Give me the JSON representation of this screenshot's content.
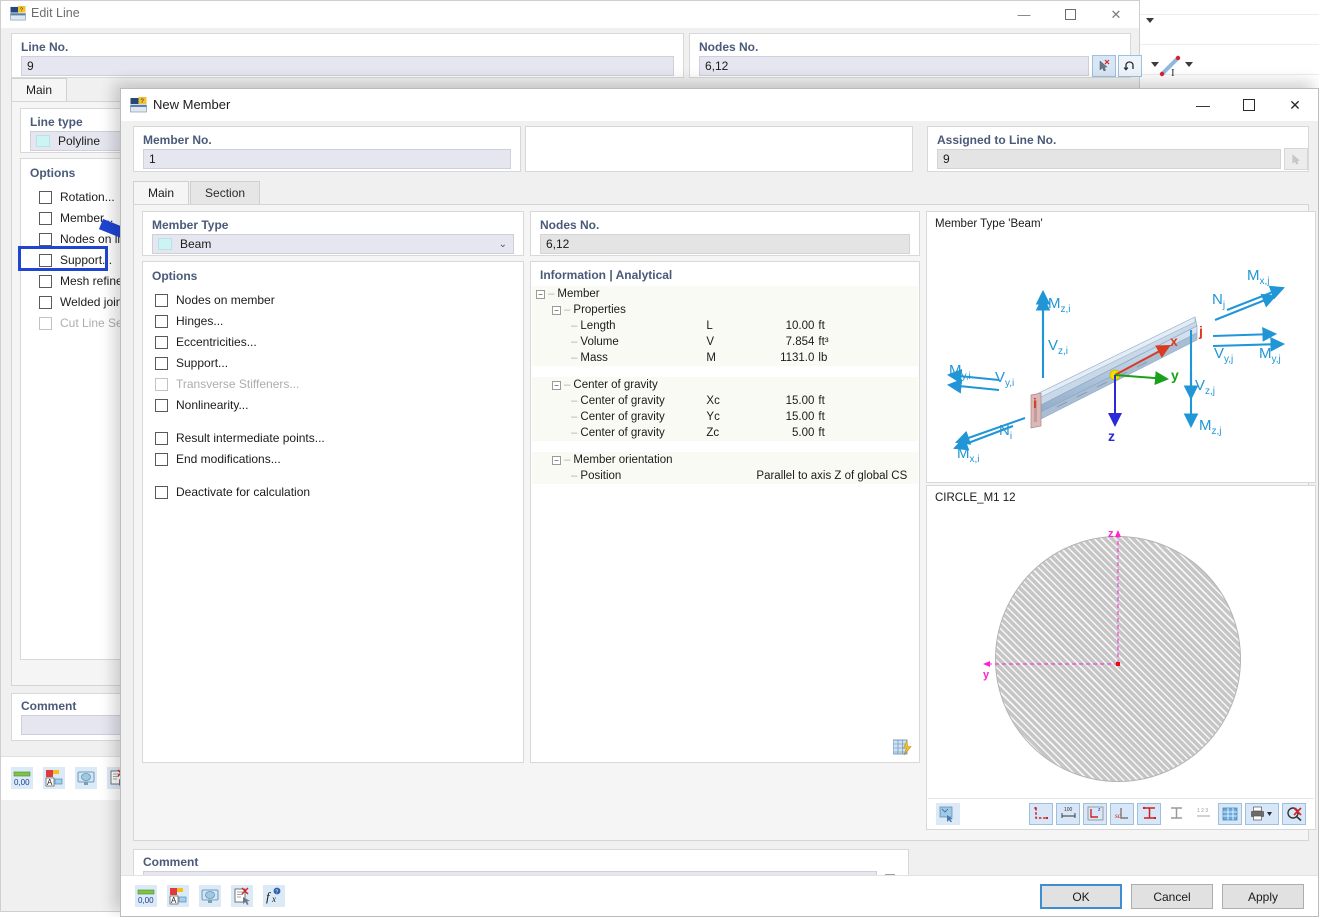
{
  "background_app": {
    "name": "rfem-model-window"
  },
  "edit_line": {
    "title": "Edit Line",
    "icon": "dialog-icon",
    "window_buttons": {
      "minimize": "—",
      "maximize": "☐",
      "close": "✕"
    },
    "line_no": {
      "label": "Line No.",
      "value": "9"
    },
    "nodes_no": {
      "label": "Nodes No.",
      "value": "6,12",
      "pick_icon": "pick-cursor-icon",
      "reverse_icon": "reverse-arrow-icon"
    },
    "tabs": [
      {
        "label": "Main",
        "active": true
      }
    ],
    "line_type": {
      "label": "Line type",
      "value": "Polyline"
    },
    "options": {
      "label": "Options",
      "items": [
        {
          "label": "Rotation...",
          "checked": false,
          "disabled": false,
          "highlighted": false
        },
        {
          "label": "Member...",
          "checked": false,
          "disabled": false,
          "highlighted": true
        },
        {
          "label": "Nodes on line...",
          "checked": false,
          "disabled": false,
          "highlighted": false
        },
        {
          "label": "Support...",
          "checked": false,
          "disabled": false,
          "highlighted": false
        },
        {
          "label": "Mesh refinement...",
          "checked": false,
          "disabled": false,
          "highlighted": false
        },
        {
          "label": "Welded joints...",
          "checked": false,
          "disabled": false,
          "highlighted": false
        },
        {
          "label": "Cut Line Settings...",
          "checked": false,
          "disabled": true,
          "highlighted": false
        }
      ]
    },
    "comment": {
      "label": "Comment",
      "value": ""
    },
    "toolbar_icons": [
      "units-icon",
      "display-properties-icon",
      "view-mode-icon",
      "delete-note-icon"
    ],
    "highlight_color": "#1f45d2",
    "arrow_color": "#1f45d2"
  },
  "new_member": {
    "title": "New Member",
    "icon": "dialog-icon",
    "window_buttons": {
      "minimize": "—",
      "maximize": "☐",
      "close": "✕"
    },
    "member_no": {
      "label": "Member No.",
      "value": "1"
    },
    "assigned_to_line": {
      "label": "Assigned to Line No.",
      "value": "9",
      "pick_icon": "pick-cursor-icon"
    },
    "tabs": [
      {
        "label": "Main",
        "active": true
      },
      {
        "label": "Section",
        "active": false
      }
    ],
    "member_type": {
      "label": "Member Type",
      "value": "Beam",
      "swatch_color": "#cdf4f4",
      "caret": "⌄"
    },
    "nodes_no": {
      "label": "Nodes No.",
      "value": "6,12"
    },
    "options": {
      "label": "Options",
      "items": [
        {
          "label": "Nodes on member",
          "checked": false,
          "disabled": false,
          "gap_after": false
        },
        {
          "label": "Hinges...",
          "checked": false,
          "disabled": false,
          "gap_after": false
        },
        {
          "label": "Eccentricities...",
          "checked": false,
          "disabled": false,
          "gap_after": false
        },
        {
          "label": "Support...",
          "checked": false,
          "disabled": false,
          "gap_after": false
        },
        {
          "label": "Transverse Stiffeners...",
          "checked": false,
          "disabled": true,
          "gap_after": false
        },
        {
          "label": "Nonlinearity...",
          "checked": false,
          "disabled": false,
          "gap_after": true
        },
        {
          "label": "Result intermediate points...",
          "checked": false,
          "disabled": false,
          "gap_after": false
        },
        {
          "label": "End modifications...",
          "checked": false,
          "disabled": false,
          "gap_after": true
        },
        {
          "label": "Deactivate for calculation",
          "checked": false,
          "disabled": false,
          "gap_after": false
        }
      ]
    },
    "information": {
      "label": "Information | Analytical",
      "rows": [
        {
          "kind": "group",
          "indent": 0,
          "expander": "−",
          "label": "Member"
        },
        {
          "kind": "group",
          "indent": 1,
          "expander": "−",
          "label": "Properties"
        },
        {
          "kind": "item",
          "indent": 2,
          "label": "Length",
          "symbol": "L",
          "value": "10.00",
          "unit": "ft"
        },
        {
          "kind": "item",
          "indent": 2,
          "label": "Volume",
          "symbol": "V",
          "value": "7.854",
          "unit": "ft³"
        },
        {
          "kind": "item",
          "indent": 2,
          "label": "Mass",
          "symbol": "M",
          "value": "1131.0",
          "unit": "lb"
        },
        {
          "kind": "blank"
        },
        {
          "kind": "group",
          "indent": 1,
          "expander": "−",
          "label": "Center of gravity"
        },
        {
          "kind": "item",
          "indent": 2,
          "label": "Center of gravity",
          "symbol": "Xc",
          "value": "15.00",
          "unit": "ft"
        },
        {
          "kind": "item",
          "indent": 2,
          "label": "Center of gravity",
          "symbol": "Yc",
          "value": "15.00",
          "unit": "ft"
        },
        {
          "kind": "item",
          "indent": 2,
          "label": "Center of gravity",
          "symbol": "Zc",
          "value": "5.00",
          "unit": "ft"
        },
        {
          "kind": "blank"
        },
        {
          "kind": "group",
          "indent": 1,
          "expander": "−",
          "label": "Member orientation"
        },
        {
          "kind": "item",
          "indent": 2,
          "label": "Position",
          "symbol": "",
          "value": "",
          "unit": "Parallel to axis Z of global CS"
        }
      ],
      "table_icon": "table-lightning-icon"
    },
    "beam_graphic": {
      "caption": "Member Type 'Beam'",
      "labels": [
        {
          "text": "M",
          "sub": "z,i"
        },
        {
          "text": "V",
          "sub": "z,i"
        },
        {
          "text": "M",
          "sub": "y,i"
        },
        {
          "text": "V",
          "sub": "y,i"
        },
        {
          "text": "N",
          "sub": "i"
        },
        {
          "text": "M",
          "sub": "x,i"
        },
        {
          "text": "M",
          "sub": "x,j"
        },
        {
          "text": "N",
          "sub": "j"
        },
        {
          "text": "V",
          "sub": "y,j"
        },
        {
          "text": "M",
          "sub": "y,j"
        },
        {
          "text": "V",
          "sub": "z,j"
        },
        {
          "text": "M",
          "sub": "z,j"
        }
      ],
      "axes": [
        "x",
        "y",
        "z"
      ],
      "nodes": [
        "i",
        "j"
      ],
      "arrow_color": "#2196d6",
      "axis_x_color": "#d93b20",
      "axis_y_color": "#1ba01b",
      "axis_z_color": "#2a2ad6"
    },
    "section_graphic": {
      "caption": "CIRCLE_M1 12",
      "axis_z_label": "z",
      "axis_y_label": "y",
      "axis_color": "#ff22d0",
      "fill_color": "#c6c6c6"
    },
    "section_toolbar_icons": [
      "import-section-icon",
      "section-outline-icon",
      "dimensions-icon",
      "section-parts-icon",
      "shear-center-icon",
      "stress-points-icon",
      "thin-walled-icon",
      "numbering-icon",
      "grid-icon",
      "print-icon",
      "print-caret",
      "zoom-reset-icon"
    ],
    "comment": {
      "label": "Comment",
      "value": "",
      "caret": "⌄",
      "copy_icon": "copy-icon"
    },
    "toolbar_icons": [
      "units-icon",
      "display-properties-icon",
      "view-mode-icon",
      "delete-note-icon",
      "formula-icon"
    ],
    "buttons": {
      "ok": "OK",
      "cancel": "Cancel",
      "apply": "Apply"
    }
  }
}
